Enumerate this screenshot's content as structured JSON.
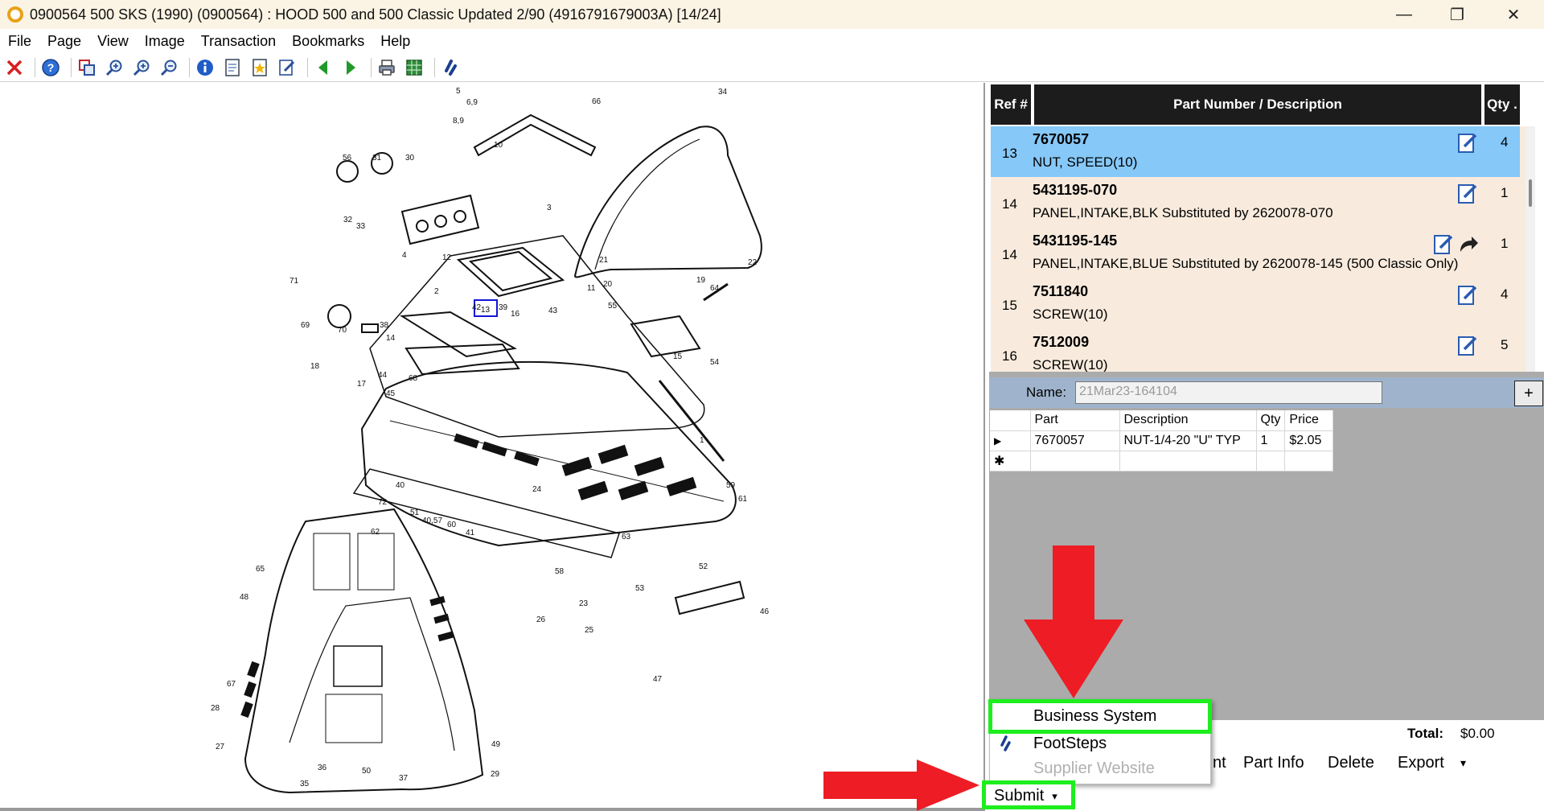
{
  "window": {
    "title": "0900564 500 SKS (1990) (0900564) : HOOD 500 and 500 Classic Updated 2/90 (4916791679003A) [14/24]",
    "minimize_glyph": "—",
    "maximize_glyph": "❐",
    "close_glyph": "✕"
  },
  "menu": [
    "File",
    "Page",
    "View",
    "Image",
    "Transaction",
    "Bookmarks",
    "Help"
  ],
  "toolbar_icons": [
    "close-x-icon",
    "help-icon",
    "copy-region-icon",
    "zoom-in-icon",
    "zoom-in-plus-icon",
    "zoom-out-icon",
    "info-icon",
    "page-icon",
    "bookmark-page-icon",
    "edit-note-icon",
    "back-arrow-icon",
    "forward-arrow-icon",
    "print-icon",
    "export-grid-icon",
    "footsteps-icon"
  ],
  "parts_header": {
    "ref": "Ref #",
    "part": "Part Number / Description",
    "qty": "Qty ."
  },
  "parts": [
    {
      "ref": "13",
      "number": "7670057",
      "description": "NUT, SPEED(10)",
      "qty": "4"
    },
    {
      "ref": "14",
      "number": "5431195-070",
      "description": "PANEL,INTAKE,BLK Substituted by 2620078-070",
      "qty": "1"
    },
    {
      "ref": "14",
      "number": "5431195-145",
      "description": "PANEL,INTAKE,BLUE Substituted by 2620078-145 (500 Classic Only)",
      "qty": "1"
    },
    {
      "ref": "15",
      "number": "7511840",
      "description": "SCREW(10)",
      "qty": "4"
    },
    {
      "ref": "16",
      "number": "7512009",
      "description": "SCREW(10)",
      "qty": "5"
    }
  ],
  "name_field": {
    "label": "Name:",
    "value": "21Mar23-164104"
  },
  "add_button": "+",
  "cart": {
    "headers": {
      "part": "Part",
      "description": "Description",
      "qty": "Qty",
      "price": "Price"
    },
    "rows": [
      {
        "marker": "▶",
        "part": "7670057",
        "description": "NUT-1/4-20 \"U\" TYP",
        "qty": "1",
        "price": "$2.05"
      }
    ],
    "new_row_marker": "✱"
  },
  "totals": {
    "label": "Total:",
    "value": "$0.00"
  },
  "actions": {
    "partial_label": "nt",
    "part_info": "Part Info",
    "delete": "Delete",
    "export": "Export",
    "export_caret": "▾"
  },
  "submit": {
    "label": "Submit",
    "caret": "▾"
  },
  "submit_menu": [
    {
      "label": "Business System",
      "enabled": true
    },
    {
      "label": "FootSteps",
      "enabled": true
    },
    {
      "label": "Supplier Website",
      "enabled": false
    }
  ],
  "diagram_callouts": [
    "1",
    "2",
    "3",
    "4",
    "5",
    "6,9",
    "8,9",
    "10",
    "11",
    "12",
    "13",
    "14",
    "15",
    "16",
    "17",
    "18",
    "19",
    "20",
    "21",
    "22",
    "23",
    "24",
    "25",
    "26",
    "27",
    "28",
    "29",
    "30",
    "31",
    "32",
    "33",
    "34",
    "35",
    "36",
    "37",
    "38",
    "39",
    "40",
    "40,57",
    "41",
    "42",
    "43",
    "44",
    "45",
    "46",
    "47",
    "48",
    "49",
    "50",
    "51",
    "52",
    "53",
    "54",
    "55",
    "56",
    "58",
    "59",
    "60",
    "61",
    "62",
    "63",
    "64",
    "65",
    "66",
    "67",
    "68",
    "69",
    "70",
    "71",
    "72"
  ],
  "colors": {
    "accent_selected_row": "#86c8f8",
    "list_background": "#f8ebdd",
    "highlight": "#1dee1d",
    "annotation_arrow": "#ee1c24"
  }
}
